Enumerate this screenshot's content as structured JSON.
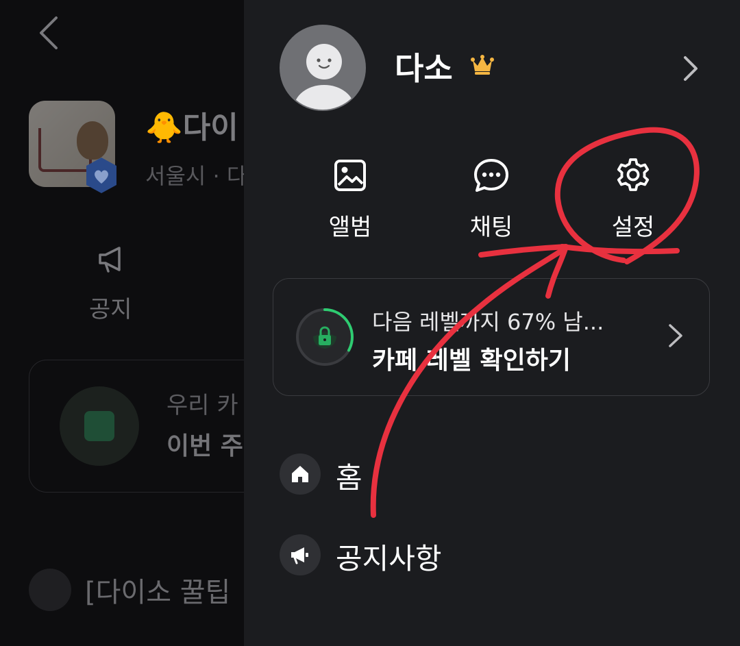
{
  "background_page": {
    "cafe_title": "🐥다이",
    "cafe_subtitle": "서울시 · 다",
    "notice_label": "공지",
    "stat_line1": "우리 카",
    "stat_line2": "이번 주",
    "tip_text": "[다이소 꿀팁"
  },
  "drawer": {
    "profile": {
      "name": "다소",
      "crown_icon": "crown-icon"
    },
    "quick_actions": [
      {
        "label": "앨범",
        "icon": "image-icon"
      },
      {
        "label": "채팅",
        "icon": "chat-bubble-icon"
      },
      {
        "label": "설정",
        "icon": "gear-icon"
      }
    ],
    "level_card": {
      "progress_text": "다음 레벨까지 67% 남...",
      "title": "카페 레벨 확인하기",
      "progress_fraction": 0.33,
      "colors": {
        "ring_progress": "#2ecc71",
        "ring_track": "#3a3b3f",
        "lock": "#27ae60"
      }
    },
    "menu": [
      {
        "label": "홈",
        "icon": "home-icon"
      },
      {
        "label": "공지사항",
        "icon": "megaphone-icon"
      }
    ]
  },
  "colors": {
    "drawer_bg": "#1b1c1f",
    "page_bg": "#0d0d0f",
    "annotation_red": "#e8313f"
  }
}
